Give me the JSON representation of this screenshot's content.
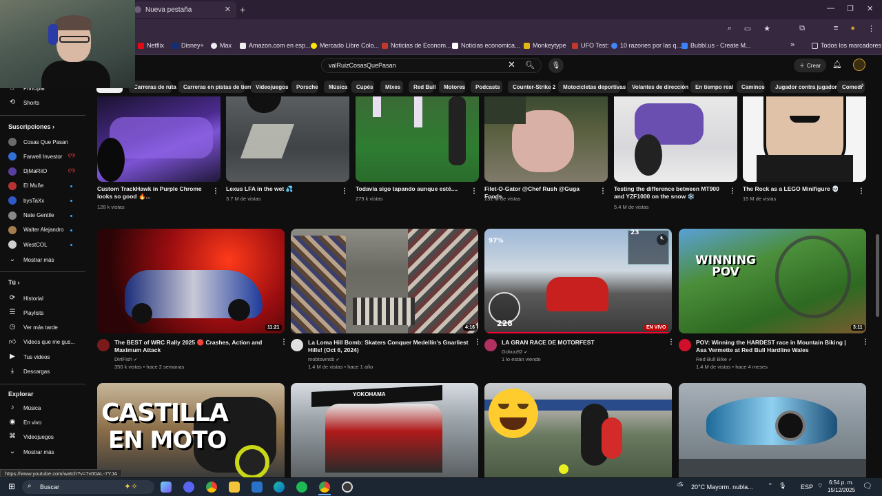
{
  "browser": {
    "tab_title": "Nueva pestaña",
    "tab_close": "✕",
    "new_tab": "+",
    "window_controls": [
      "—",
      "❐",
      "✕"
    ],
    "bookmarks": [
      "Netflix",
      "Disney+",
      "Max",
      "Amazon.com en esp...",
      "Mercado Libre Colo...",
      "Noticias de Econom...",
      "Noticias economica...",
      "Monkeytype",
      "UFO Test:",
      "10 razones por las q...",
      "Bubbl.us - Create M..."
    ],
    "bookmarks_overflow": "»",
    "all_bookmarks": "Todos los marcadores",
    "status_url": "https://www.youtube.com/watch?v=7v00AL-7YJA"
  },
  "youtube": {
    "search_value": "valRuizCosasQuePasan",
    "create_label": "Crear",
    "chips": [
      "Carreras de ruta",
      "Carreras en pistas de tierra",
      "Videojuegos",
      "Porsche",
      "Música",
      "Cupés",
      "Mixes",
      "Red Bull",
      "Motores",
      "Podcasts",
      "Counter-Strike 2",
      "Motocicletas deportivas",
      "Volantes de dirección",
      "En tiempo real",
      "Caminos",
      "Jugador contra jugador",
      "Comedi"
    ]
  },
  "sidebar": {
    "principal": "Principal",
    "shorts": "Shorts",
    "subs_header": "Suscripciones",
    "subs": [
      {
        "name": "Cosas Que Pasan",
        "color": "#6b6b6b",
        "mark": ""
      },
      {
        "name": "Farwell Investor",
        "color": "#2f6fd6",
        "mark": "live"
      },
      {
        "name": "DjMaRiiO",
        "color": "#5a3fa0",
        "mark": "live"
      },
      {
        "name": "El Muñe",
        "color": "#b83232",
        "mark": "dot"
      },
      {
        "name": "bysTaXx",
        "color": "#2f58c9",
        "mark": "dot"
      },
      {
        "name": "Nate Gentile",
        "color": "#888888",
        "mark": "dot"
      },
      {
        "name": "Walter Alejandro",
        "color": "#a57c4c",
        "mark": "dot"
      },
      {
        "name": "WestCOL",
        "color": "#cfcfcf",
        "mark": "dot"
      }
    ],
    "show_more": "Mostrar más",
    "you_header": "Tú",
    "you_items": [
      "Historial",
      "Playlists",
      "Ver más tarde",
      "Videos que me gus...",
      "Tus videos",
      "Descargas"
    ],
    "explore_header": "Explorar",
    "explore_items": [
      "Música",
      "En vivo",
      "Videojuegos",
      "Mostrar más"
    ]
  },
  "shorts_row": [
    {
      "title": "Custom TrackHawk in Purple Chrome looks so good 🔥...",
      "views": "128 k vistas"
    },
    {
      "title": "Lexus LFA in the wet 💦",
      "views": "3.7 M de vistas"
    },
    {
      "title": "Todavía sigo tapando aunque esté....",
      "views": "279 k vistas"
    },
    {
      "title": "Filet-O-Gator @Chef Rush @Guga Foods",
      "views": "231 M de vistas"
    },
    {
      "title": "Testing the difference between MT900 and YZF1000 on the snow ❄️",
      "views": "5.4 M de vistas"
    },
    {
      "title": "The Rock as a LEGO Minifigure 💀",
      "views": "15 M de vistas"
    }
  ],
  "videos_row": [
    {
      "title": "The BEST of WRC Rally 2025 🔴 Crashes, Action and Maximum Attack",
      "channel": "DirtFish",
      "meta": "350 k vistas • hace 2 semanas",
      "duration": "11:21"
    },
    {
      "title": "La Loma Hill Bomb: Skaters Conquer Medellín's Gnarliest Hills! (Oct 6, 2024)",
      "channel": "mobtownsb",
      "meta": "1.4 M de vistas • hace 1 año",
      "duration": "4:16"
    },
    {
      "title": "LA GRAN RACE DE MOTORFEST",
      "channel": "Gokuu92",
      "meta": "1 lo están viendo",
      "duration": "EN VIVO",
      "hud_speed": "228",
      "hud_pct": "97%",
      "hud_lap": "23"
    },
    {
      "title": "POV: Winning the HARDEST race in Mountain Biking | Asa Vermette at Red Bull Hardline Wales",
      "channel": "Red Bull Bike",
      "meta": "1.4 M de vistas • hace 4 meses",
      "duration": "3:11",
      "overlay": "WINNING POV"
    }
  ],
  "bottom_row": {
    "castilla": "CASTILLA",
    "en_moto": "EN MOTO",
    "yokohama": "YOKOHAMA"
  },
  "taskbar": {
    "search": "Buscar",
    "weather": "20°C  Mayorm. nubla...",
    "lang": "ESP",
    "time": "6:54 p. m.",
    "date": "15/12/2025"
  },
  "colors": {
    "bg": "#0f0f0f",
    "chip": "#272727",
    "red": "#ff0033",
    "meta": "#aaaaaa"
  }
}
